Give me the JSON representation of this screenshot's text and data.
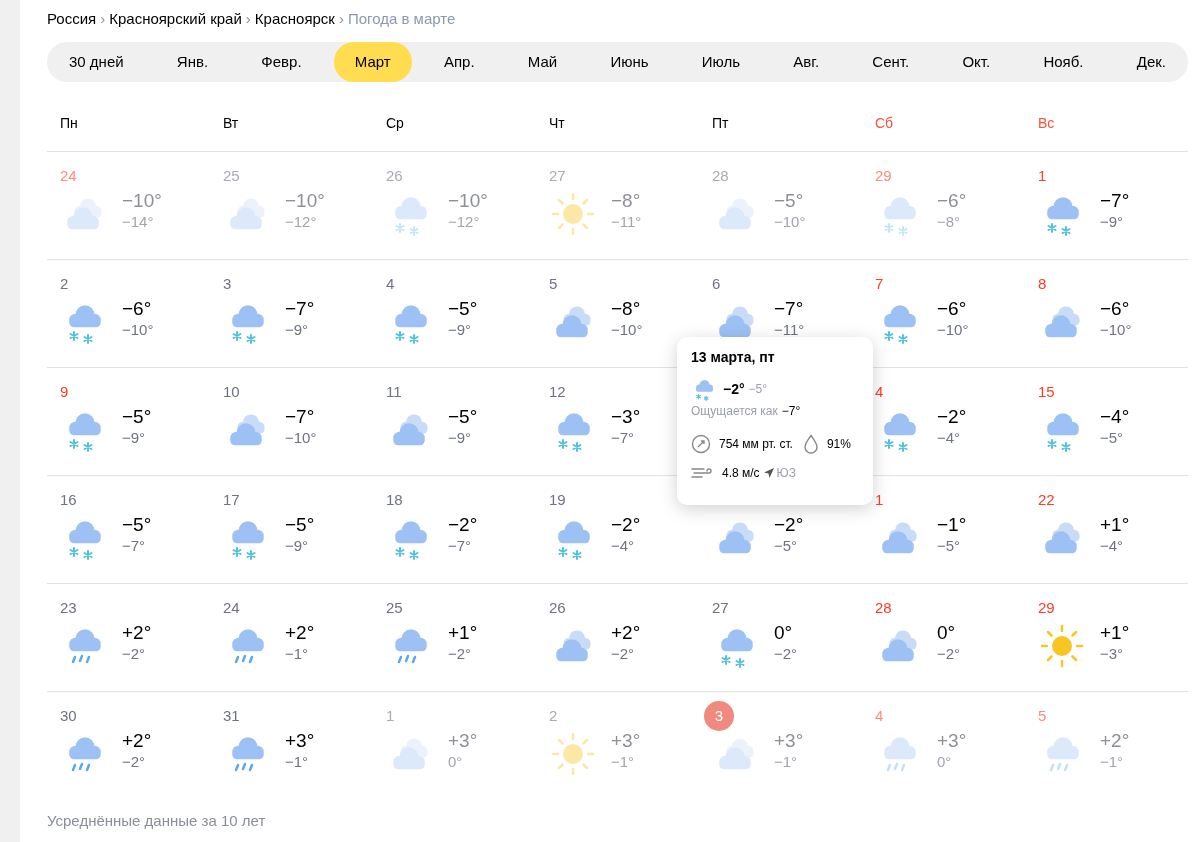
{
  "breadcrumbs": [
    {
      "label": "Россия",
      "current": false
    },
    {
      "label": "Красноярский край",
      "current": false
    },
    {
      "label": "Красноярск",
      "current": false
    },
    {
      "label": "Погода в марте",
      "current": true
    }
  ],
  "separator": "›",
  "tabs": [
    {
      "label": "30 дней",
      "selected": false
    },
    {
      "label": "Янв.",
      "selected": false
    },
    {
      "label": "Февр.",
      "selected": false
    },
    {
      "label": "Март",
      "selected": true
    },
    {
      "label": "Апр.",
      "selected": false
    },
    {
      "label": "Май",
      "selected": false
    },
    {
      "label": "Июнь",
      "selected": false
    },
    {
      "label": "Июль",
      "selected": false
    },
    {
      "label": "Авг.",
      "selected": false
    },
    {
      "label": "Сент.",
      "selected": false
    },
    {
      "label": "Окт.",
      "selected": false
    },
    {
      "label": "Нояб.",
      "selected": false
    },
    {
      "label": "Дек.",
      "selected": false
    }
  ],
  "weekdays": [
    {
      "label": "Пн",
      "weekend": false
    },
    {
      "label": "Вт",
      "weekend": false
    },
    {
      "label": "Ср",
      "weekend": false
    },
    {
      "label": "Чт",
      "weekend": false
    },
    {
      "label": "Пт",
      "weekend": false
    },
    {
      "label": "Сб",
      "weekend": true
    },
    {
      "label": "Вс",
      "weekend": true
    }
  ],
  "weeks": [
    [
      {
        "kind": "cloudy",
        "day": "24",
        "weekend": true,
        "muted": true,
        "today": false,
        "high": "−10°",
        "low": "−14°"
      },
      {
        "kind": "cloudy",
        "day": "25",
        "weekend": false,
        "muted": true,
        "today": false,
        "high": "−10°",
        "low": "−12°"
      },
      {
        "kind": "snow",
        "day": "26",
        "weekend": false,
        "muted": true,
        "today": false,
        "high": "−10°",
        "low": "−12°"
      },
      {
        "kind": "sun",
        "day": "27",
        "weekend": false,
        "muted": true,
        "today": false,
        "high": "−8°",
        "low": "−11°"
      },
      {
        "kind": "cloudy",
        "day": "28",
        "weekend": false,
        "muted": true,
        "today": false,
        "high": "−5°",
        "low": "−10°"
      },
      {
        "kind": "snow",
        "day": "29",
        "weekend": true,
        "muted": true,
        "today": false,
        "high": "−6°",
        "low": "−8°"
      },
      {
        "kind": "snow",
        "day": "1",
        "weekend": true,
        "muted": false,
        "today": false,
        "high": "−7°",
        "low": "−9°"
      }
    ],
    [
      {
        "kind": "snow",
        "day": "2",
        "weekend": false,
        "muted": false,
        "today": false,
        "high": "−6°",
        "low": "−10°"
      },
      {
        "kind": "snow",
        "day": "3",
        "weekend": false,
        "muted": false,
        "today": false,
        "high": "−7°",
        "low": "−9°"
      },
      {
        "kind": "snow",
        "day": "4",
        "weekend": false,
        "muted": false,
        "today": false,
        "high": "−5°",
        "low": "−9°"
      },
      {
        "kind": "cloudy",
        "day": "5",
        "weekend": false,
        "muted": false,
        "today": false,
        "high": "−8°",
        "low": "−10°"
      },
      {
        "kind": "cloudy",
        "day": "6",
        "weekend": false,
        "muted": false,
        "today": false,
        "high": "−7°",
        "low": "−11°"
      },
      {
        "kind": "snow",
        "day": "7",
        "weekend": true,
        "muted": false,
        "today": false,
        "high": "−6°",
        "low": "−10°"
      },
      {
        "kind": "cloudy",
        "day": "8",
        "weekend": true,
        "muted": false,
        "today": false,
        "high": "−6°",
        "low": "−10°"
      }
    ],
    [
      {
        "kind": "snow",
        "day": "9",
        "weekend": true,
        "muted": false,
        "today": false,
        "high": "−5°",
        "low": "−9°"
      },
      {
        "kind": "cloudy",
        "day": "10",
        "weekend": false,
        "muted": false,
        "today": false,
        "high": "−7°",
        "low": "−10°"
      },
      {
        "kind": "cloudy",
        "day": "11",
        "weekend": false,
        "muted": false,
        "today": false,
        "high": "−5°",
        "low": "−9°"
      },
      {
        "kind": "snow",
        "day": "12",
        "weekend": false,
        "muted": false,
        "today": false,
        "high": "−3°",
        "low": "−7°"
      },
      {
        "kind": "covered"
      },
      {
        "kind": "snow",
        "day": "4",
        "weekend": true,
        "muted": false,
        "today": false,
        "high": "−2°",
        "low": "−4°"
      },
      {
        "kind": "snow",
        "day": "15",
        "weekend": true,
        "muted": false,
        "today": false,
        "high": "−4°",
        "low": "−5°"
      }
    ],
    [
      {
        "kind": "snow",
        "day": "16",
        "weekend": false,
        "muted": false,
        "today": false,
        "high": "−5°",
        "low": "−7°"
      },
      {
        "kind": "snow",
        "day": "17",
        "weekend": false,
        "muted": false,
        "today": false,
        "high": "−5°",
        "low": "−9°"
      },
      {
        "kind": "snow",
        "day": "18",
        "weekend": false,
        "muted": false,
        "today": false,
        "high": "−2°",
        "low": "−7°"
      },
      {
        "kind": "snow",
        "day": "19",
        "weekend": false,
        "muted": false,
        "today": false,
        "high": "−2°",
        "low": "−4°"
      },
      {
        "kind": "cloudy",
        "muted": false,
        "high": "−2°",
        "low": "−5°"
      },
      {
        "kind": "cloudy",
        "day": "1",
        "weekend": true,
        "muted": false,
        "today": false,
        "high": "−1°",
        "low": "−5°"
      },
      {
        "kind": "cloudy",
        "day": "22",
        "weekend": true,
        "muted": false,
        "today": false,
        "high": "+1°",
        "low": "−4°"
      }
    ],
    [
      {
        "kind": "rain",
        "day": "23",
        "weekend": false,
        "muted": false,
        "today": false,
        "high": "+2°",
        "low": "−2°"
      },
      {
        "kind": "rain",
        "day": "24",
        "weekend": false,
        "muted": false,
        "today": false,
        "high": "+2°",
        "low": "−1°"
      },
      {
        "kind": "rain",
        "day": "25",
        "weekend": false,
        "muted": false,
        "today": false,
        "high": "+1°",
        "low": "−2°"
      },
      {
        "kind": "cloudy",
        "day": "26",
        "weekend": false,
        "muted": false,
        "today": false,
        "high": "+2°",
        "low": "−2°"
      },
      {
        "kind": "snow",
        "day": "27",
        "weekend": false,
        "muted": false,
        "today": false,
        "high": "0°",
        "low": "−2°"
      },
      {
        "kind": "cloudy",
        "day": "28",
        "weekend": true,
        "muted": false,
        "today": false,
        "high": "0°",
        "low": "−2°"
      },
      {
        "kind": "sun",
        "day": "29",
        "weekend": true,
        "muted": false,
        "today": false,
        "high": "+1°",
        "low": "−3°"
      }
    ],
    [
      {
        "kind": "rain",
        "day": "30",
        "weekend": false,
        "muted": false,
        "today": false,
        "high": "+2°",
        "low": "−2°"
      },
      {
        "kind": "rain",
        "day": "31",
        "weekend": false,
        "muted": false,
        "today": false,
        "high": "+3°",
        "low": "−1°"
      },
      {
        "kind": "cloudy",
        "day": "1",
        "weekend": false,
        "muted": true,
        "today": false,
        "high": "+3°",
        "low": "0°"
      },
      {
        "kind": "sun",
        "day": "2",
        "weekend": false,
        "muted": true,
        "today": false,
        "high": "+3°",
        "low": "−1°"
      },
      {
        "kind": "cloudy",
        "day": "3",
        "weekend": false,
        "muted": true,
        "today": true,
        "high": "+3°",
        "low": "−1°"
      },
      {
        "kind": "rain",
        "day": "4",
        "weekend": true,
        "muted": true,
        "today": false,
        "high": "+3°",
        "low": "0°"
      },
      {
        "kind": "rain",
        "day": "5",
        "weekend": true,
        "muted": true,
        "today": false,
        "high": "+2°",
        "low": "−1°"
      }
    ]
  ],
  "tooltip": {
    "title": "13 марта, пт",
    "kind": "snow",
    "high": "−2°",
    "low": "−5°",
    "feels_label": "Ощущается как",
    "feels_value": "−7°",
    "pressure": "754 мм рт. ст.",
    "humidity": "91%",
    "wind": "4.8 м/с",
    "direction": "ЮЗ"
  },
  "footnote": "Усреднённые данные за 10 лет"
}
